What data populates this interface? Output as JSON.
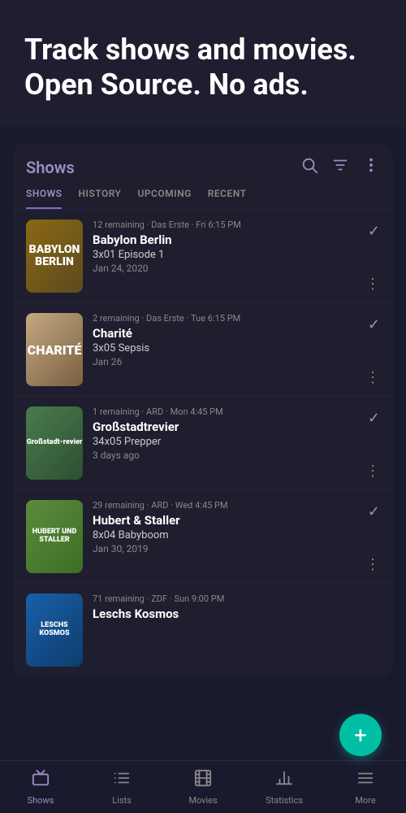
{
  "hero": {
    "title": "Track shows and movies. Open Source. No ads."
  },
  "card": {
    "title": "Shows",
    "tabs": [
      {
        "label": "SHOWS",
        "active": true
      },
      {
        "label": "HISTORY",
        "active": false
      },
      {
        "label": "UPCOMING",
        "active": false
      },
      {
        "label": "RECENT",
        "active": false
      }
    ],
    "shows": [
      {
        "id": 1,
        "poster_style": "poster-babylon",
        "poster_text": "BABYLON BERLIN",
        "remaining": "12 remaining",
        "channel": "Das Erste",
        "time": "Fri 6:15 PM",
        "name": "Babylon Berlin",
        "episode": "3x01 Episode 1",
        "date": "Jan 24, 2020",
        "checked": true
      },
      {
        "id": 2,
        "poster_style": "poster-charite",
        "poster_text": "CHARITÉ",
        "remaining": "2 remaining",
        "channel": "Das Erste",
        "time": "Tue 6:15 PM",
        "name": "Charité",
        "episode": "3x05 Sepsis",
        "date": "Jan 26",
        "checked": true
      },
      {
        "id": 3,
        "poster_style": "poster-gross",
        "poster_text": "Großstadt-revier",
        "remaining": "1 remaining",
        "channel": "ARD",
        "time": "Mon 4:45 PM",
        "name": "Großstadtrevier",
        "episode": "34x05 Prepper",
        "date": "3 days ago",
        "checked": true
      },
      {
        "id": 4,
        "poster_style": "poster-hubert",
        "poster_text": "HUBERT UND STALLER",
        "remaining": "29 remaining",
        "channel": "ARD",
        "time": "Wed 4:45 PM",
        "name": "Hubert & Staller",
        "episode": "8x04 Babyboom",
        "date": "Jan 30, 2019",
        "checked": true
      },
      {
        "id": 5,
        "poster_style": "poster-leschs",
        "poster_text": "LESCHS KOSMOS",
        "remaining": "71 remaining",
        "channel": "ZDF",
        "time": "Sun 9:00 PM",
        "name": "Leschs Kosmos",
        "episode": "",
        "date": "",
        "checked": false
      }
    ]
  },
  "fab": {
    "label": "+"
  },
  "bottom_nav": {
    "items": [
      {
        "label": "Shows",
        "icon": "tv",
        "active": true
      },
      {
        "label": "Lists",
        "icon": "list",
        "active": false
      },
      {
        "label": "Movies",
        "icon": "film",
        "active": false
      },
      {
        "label": "Statistics",
        "icon": "bar-chart",
        "active": false
      },
      {
        "label": "More",
        "icon": "more",
        "active": false
      }
    ]
  }
}
